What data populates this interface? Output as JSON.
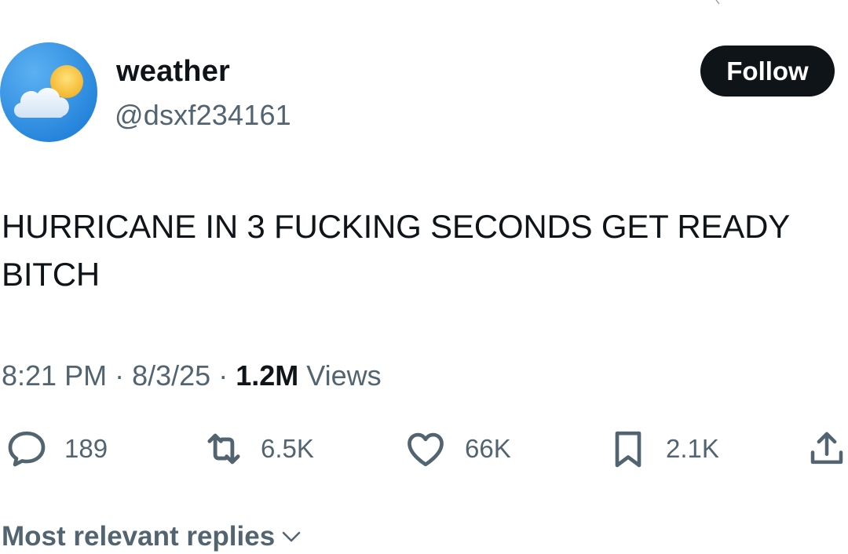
{
  "author": {
    "avatar_icon": "sun-cloud-icon",
    "display_name": "weather",
    "handle": "@dsxf234161",
    "follow_label": "Follow"
  },
  "tweet": {
    "text": "HURRICANE IN 3 FUCKING SECONDS GET READY BITCH",
    "time": "8:21 PM",
    "date": "8/3/25",
    "separator": "·",
    "views_count": "1.2M",
    "views_label": "Views"
  },
  "actions": {
    "replies": {
      "icon": "reply-icon",
      "count": "189"
    },
    "reposts": {
      "icon": "repost-icon",
      "count": "6.5K"
    },
    "likes": {
      "icon": "heart-icon",
      "count": "66K"
    },
    "bookmarks": {
      "icon": "bookmark-icon",
      "count": "2.1K"
    },
    "share": {
      "icon": "share-icon"
    }
  },
  "replies_sort": {
    "label": "Most relevant replies",
    "icon": "chevron-down-icon"
  },
  "colors": {
    "text_primary": "#0f1419",
    "text_secondary": "#536471",
    "follow_bg": "#0f1419",
    "avatar_sky": "#2d8de0",
    "avatar_sun": "#f5c33b"
  }
}
